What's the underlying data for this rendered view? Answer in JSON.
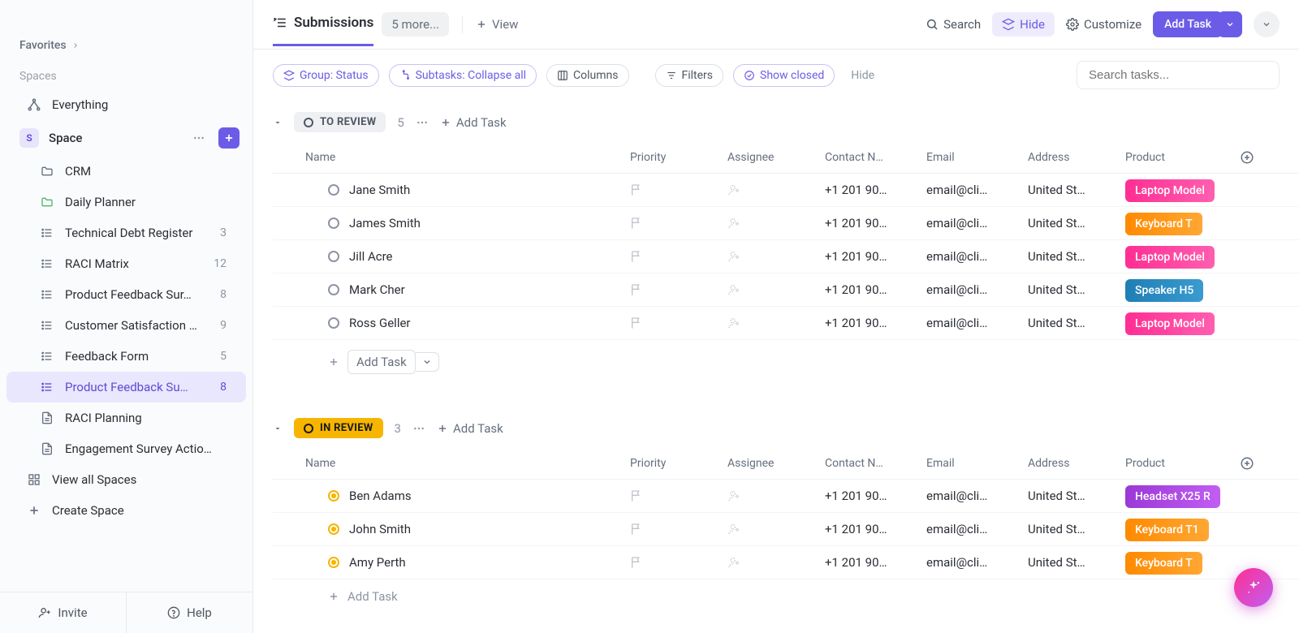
{
  "sidebar": {
    "favorites_label": "Favorites",
    "spaces_label": "Spaces",
    "everything_label": "Everything",
    "space_initial": "S",
    "space_label": "Space",
    "items": [
      {
        "label": "CRM",
        "count": "",
        "type": "folder"
      },
      {
        "label": "Daily Planner",
        "count": "",
        "type": "folder-green"
      },
      {
        "label": "Technical Debt Register",
        "count": "3",
        "type": "list"
      },
      {
        "label": "RACI Matrix",
        "count": "12",
        "type": "list"
      },
      {
        "label": "Product Feedback Sur…",
        "count": "8",
        "type": "list"
      },
      {
        "label": "Customer Satisfaction …",
        "count": "9",
        "type": "list"
      },
      {
        "label": "Feedback Form",
        "count": "5",
        "type": "list"
      },
      {
        "label": "Product Feedback Su…",
        "count": "8",
        "type": "list",
        "active": true
      },
      {
        "label": "RACI Planning",
        "count": "",
        "type": "doc"
      },
      {
        "label": "Engagement Survey Actio…",
        "count": "",
        "type": "doc"
      }
    ],
    "view_all_label": "View all Spaces",
    "create_space_label": "Create Space",
    "invite_label": "Invite",
    "help_label": "Help"
  },
  "topbar": {
    "tab_label": "Submissions",
    "more_label": "5 more...",
    "view_label": "View",
    "search_label": "Search",
    "hide_label": "Hide",
    "customize_label": "Customize",
    "add_task_label": "Add Task"
  },
  "filters": {
    "group_label": "Group: Status",
    "subtasks_label": "Subtasks: Collapse all",
    "columns_label": "Columns",
    "filters_label": "Filters",
    "closed_label": "Show closed",
    "hide_link": "Hide",
    "search_placeholder": "Search tasks..."
  },
  "columns": {
    "name": "Name",
    "priority": "Priority",
    "assignee": "Assignee",
    "contact": "Contact N…",
    "email": "Email",
    "address": "Address",
    "product": "Product"
  },
  "groups": [
    {
      "id": "to_review",
      "label": "TO REVIEW",
      "count": "5",
      "style": "review",
      "add_task_label": "Add Task",
      "footer_add": "Add Task",
      "tasks": [
        {
          "name": "Jane Smith",
          "contact": "+1 201 90…",
          "email": "email@cli…",
          "address": "United St…",
          "product": "Laptop Model",
          "pclass": "pink"
        },
        {
          "name": "James Smith",
          "contact": "+1 201 90…",
          "email": "email@cli…",
          "address": "United St…",
          "product": "Keyboard T",
          "pclass": "orange"
        },
        {
          "name": "Jill Acre",
          "contact": "+1 201 90…",
          "email": "email@cli…",
          "address": "United St…",
          "product": "Laptop Model",
          "pclass": "pink"
        },
        {
          "name": "Mark Cher",
          "contact": "+1 201 90…",
          "email": "email@cli…",
          "address": "United St…",
          "product": "Speaker H5",
          "pclass": "blue"
        },
        {
          "name": "Ross Geller",
          "contact": "+1 201 90…",
          "email": "email@cli…",
          "address": "United St…",
          "product": "Laptop Model",
          "pclass": "pink"
        }
      ]
    },
    {
      "id": "in_review",
      "label": "IN REVIEW",
      "count": "3",
      "style": "inreview",
      "add_task_label": "Add Task",
      "footer_add": "Add Task",
      "tasks": [
        {
          "name": "Ben Adams",
          "contact": "+1 201 90…",
          "email": "email@cli…",
          "address": "United St…",
          "product": "Headset X25 R",
          "pclass": "purple"
        },
        {
          "name": "John Smith",
          "contact": "+1 201 90…",
          "email": "email@cli…",
          "address": "United St…",
          "product": "Keyboard T1",
          "pclass": "orange"
        },
        {
          "name": "Amy Perth",
          "contact": "+1 201 90…",
          "email": "email@cli…",
          "address": "United St…",
          "product": "Keyboard T",
          "pclass": "orange"
        }
      ]
    }
  ]
}
